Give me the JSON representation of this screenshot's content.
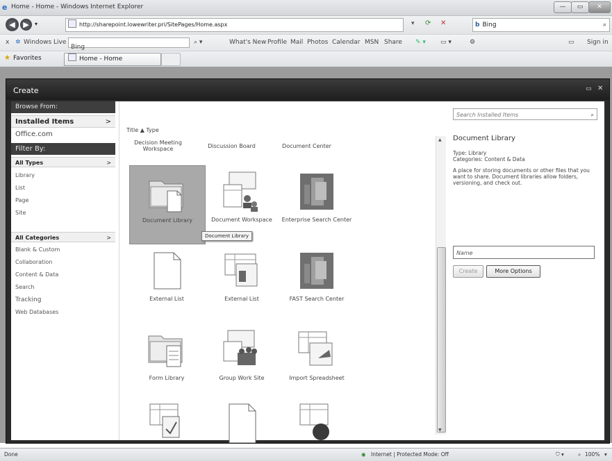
{
  "window": {
    "title": "Home - Home - Windows Internet Explorer",
    "min": "—",
    "max": "▭",
    "close": "✕"
  },
  "address": {
    "url": "http://sharepoint.lowewriter.pri/SitePages/Home.aspx",
    "search_value": "Bing"
  },
  "wl": {
    "close": "x",
    "brand": "Windows Live",
    "search_value": "Bing",
    "links": [
      "What's New",
      "Profile",
      "Mail",
      "Photos",
      "Calendar",
      "MSN",
      "Share"
    ],
    "signin": "Sign in"
  },
  "favorites": {
    "label": "Favorites",
    "tab": "Home - Home"
  },
  "dialog": {
    "title": "Create"
  },
  "leftnav": {
    "browse_header": "Browse From:",
    "installed": "Installed Items",
    "office": "Office.com",
    "filter_header": "Filter By:",
    "all_types": "All Types",
    "types": [
      "Library",
      "List",
      "Page",
      "Site"
    ],
    "all_categories": "All Categories",
    "categories": [
      "Blank & Custom",
      "Collaboration",
      "Content & Data",
      "Search",
      "Tracking",
      "Web Databases"
    ],
    "chevron": ">"
  },
  "center": {
    "sort": "Title ▲  Type",
    "top_labels": [
      "Decision Meeting Workspace",
      "Discussion Board",
      "Document Center"
    ],
    "tiles": [
      {
        "label": "Document Library",
        "icon": "document-library-icon"
      },
      {
        "label": "Document Workspace",
        "icon": "document-workspace-icon"
      },
      {
        "label": "Enterprise Search Center",
        "icon": "enterprise-search-center-icon"
      },
      {
        "label": "External List",
        "icon": "external-list-icon"
      },
      {
        "label": "External List",
        "icon": "external-list-table-icon"
      },
      {
        "label": "FAST Search Center",
        "icon": "fast-search-center-icon"
      },
      {
        "label": "Form Library",
        "icon": "form-library-icon"
      },
      {
        "label": "Group Work Site",
        "icon": "group-work-site-icon"
      },
      {
        "label": "Import Spreadsheet",
        "icon": "import-spreadsheet-icon"
      }
    ],
    "tooltip": "Document Library",
    "scroll_up": "▲",
    "scroll_down": "▼"
  },
  "right": {
    "search_placeholder": "Search Installed Items",
    "title": "Document Library",
    "type_line": "Type: Library",
    "categories_line": "Categories: Content & Data",
    "description": "A place for storing documents or other files that you want to share. Document libraries allow folders, versioning, and check out.",
    "name_placeholder": "Name",
    "create": "Create",
    "more": "More Options"
  },
  "status": {
    "left": "Done",
    "zone": "Internet | Protected Mode: Off",
    "zoom": "100%"
  }
}
